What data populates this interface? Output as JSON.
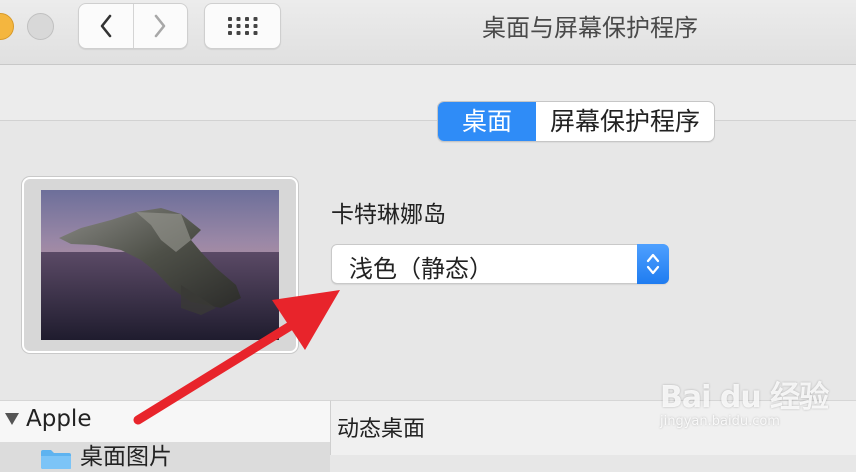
{
  "window": {
    "title": "桌面与屏幕保护程序"
  },
  "toolbar": {
    "back_icon": "chevron-left-icon",
    "forward_icon": "chevron-right-icon",
    "show_all_icon": "grid-icon"
  },
  "tabs": [
    {
      "label": "桌面",
      "active": true
    },
    {
      "label": "屏幕保护程序",
      "active": false
    }
  ],
  "desktop": {
    "picture_name": "卡特琳娜岛",
    "appearance_popup": {
      "selected": "浅色（静态）"
    }
  },
  "source_list": {
    "group": "Apple",
    "items": [
      {
        "label": "桌面图片"
      }
    ]
  },
  "content": {
    "header": "动态桌面"
  },
  "watermark": {
    "main": "Bai du 经验",
    "sub": "jingyan.baidu.com"
  },
  "colors": {
    "accent": "#2f8cf7",
    "arrow": "#e8242b"
  }
}
